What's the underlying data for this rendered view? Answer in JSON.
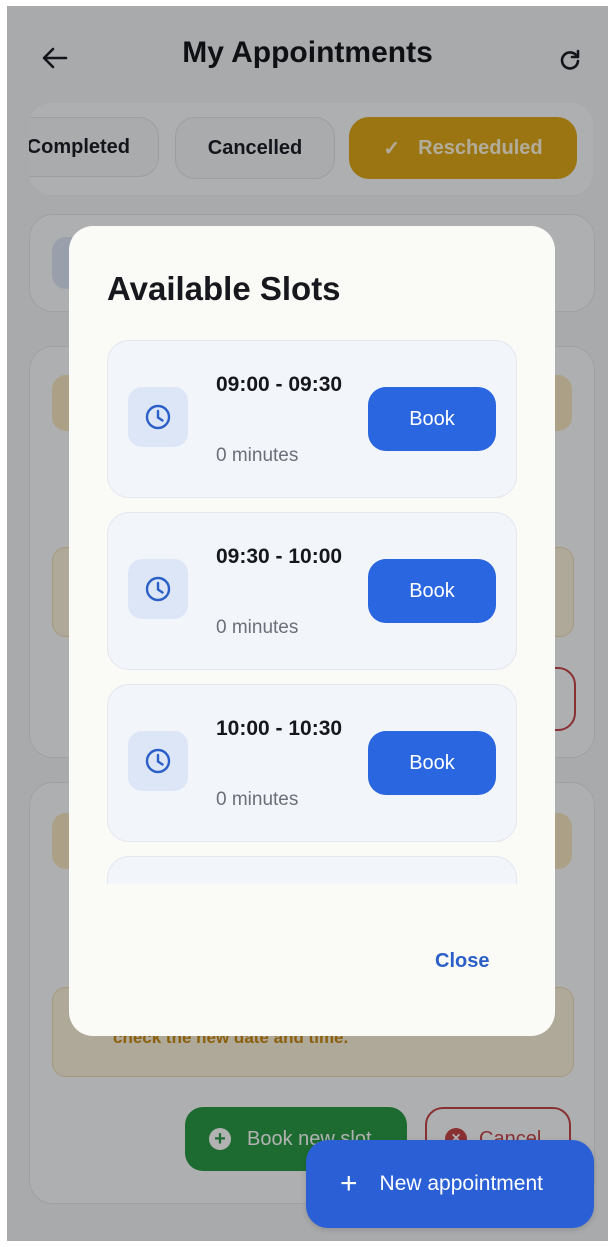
{
  "header": {
    "title": "My Appointments",
    "back_icon": "arrow-left-icon",
    "refresh_icon": "refresh-icon"
  },
  "filters": {
    "chips": [
      {
        "label": "Completed",
        "selected": false
      },
      {
        "label": "Cancelled",
        "selected": false
      },
      {
        "label": "Rescheduled",
        "selected": true
      }
    ],
    "selected_color": "#e0a81c"
  },
  "background_card": {
    "notice_text": "check the new date and time.",
    "book_new_slot_label": "Book new slot",
    "cancel_label": "Cancel"
  },
  "fab": {
    "label": "New appointment",
    "icon": "plus-icon"
  },
  "dialog": {
    "title": "Available Slots",
    "slots": [
      {
        "time": "09:00 - 09:30",
        "duration": "0 minutes",
        "book_label": "Book"
      },
      {
        "time": "09:30 - 10:00",
        "duration": "0 minutes",
        "book_label": "Book"
      },
      {
        "time": "10:00 - 10:30",
        "duration": "0 minutes",
        "book_label": "Book"
      }
    ],
    "close_label": "Close"
  },
  "colors": {
    "primary": "#2a66e0",
    "success": "#2a9a46",
    "danger": "#c4454a",
    "warning": "#e0a81c"
  }
}
